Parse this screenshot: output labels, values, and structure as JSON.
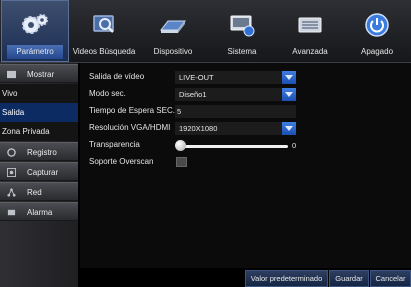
{
  "top_tabs": [
    {
      "label": "Parámetro",
      "icon": "gears-icon",
      "active": true
    },
    {
      "label": "Videos Búsqueda",
      "icon": "video-search-icon",
      "active": false
    },
    {
      "label": "Dispositivo",
      "icon": "hard-drive-icon",
      "active": false
    },
    {
      "label": "Sistema",
      "icon": "system-monitor-icon",
      "active": false
    },
    {
      "label": "Avanzada",
      "icon": "advanced-settings-icon",
      "active": false
    },
    {
      "label": "Apagado",
      "icon": "power-icon",
      "active": false
    }
  ],
  "sidebar": {
    "mostrar": "Mostrar",
    "vivo": "Vivo",
    "salida": "Salida",
    "zona_privada": "Zona Privada",
    "registro": "Registro",
    "capturar": "Capturar",
    "red": "Red",
    "alarma": "Alarma"
  },
  "form": {
    "video_output": {
      "label": "Salida de vídeo",
      "value": "LIVE-OUT"
    },
    "sequence_mode": {
      "label": "Modo sec.",
      "value": "Diseño1"
    },
    "sequence_wait": {
      "label": "Tiempo de Espera SEC.",
      "value": "5"
    },
    "vga_hdmi_resolution": {
      "label": "Resolución VGA/HDMI",
      "value": "1920X1080"
    },
    "transparency": {
      "label": "Transparencia",
      "value": "0"
    },
    "overscan": {
      "label": "Soporte Overscan",
      "checked": false
    }
  },
  "buttons": {
    "default": "Valor predeterminado",
    "save": "Guardar",
    "cancel": "Cancelar"
  },
  "colors": {
    "active_blue": "#0d2b63",
    "accent_blue": "#2e63c8"
  }
}
